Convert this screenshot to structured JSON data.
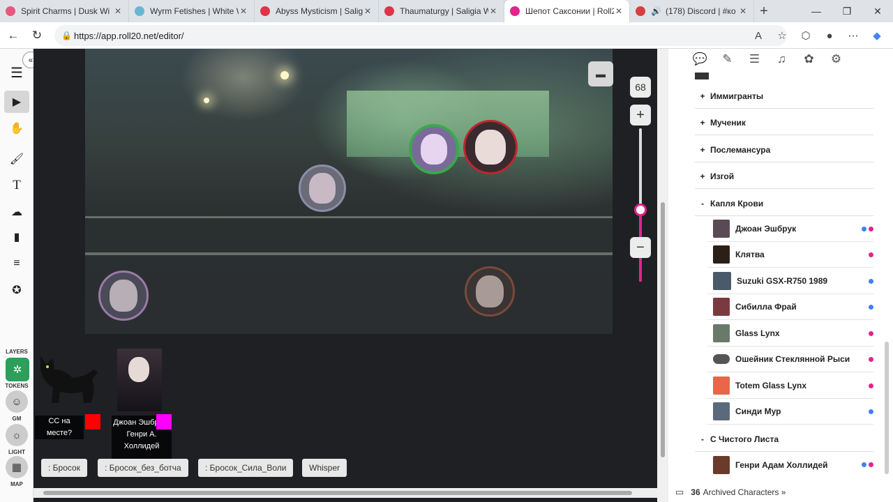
{
  "browser": {
    "tabs": [
      {
        "title": "Spirit Charms | Dusk Wi",
        "color": "#e8577d"
      },
      {
        "title": "Wyrm Fetishes | White W",
        "color": "#67b7d1"
      },
      {
        "title": "Abyss Mysticism | Saligia",
        "color": "#e0334a"
      },
      {
        "title": "Thaumaturgy | Saligia W",
        "color": "#e0334a"
      },
      {
        "title": "Шепот Саксонии | Roll2",
        "color": "#e5238a"
      },
      {
        "title": "(178) Discord | #ко",
        "color": "#d63f3f"
      }
    ],
    "new_tab_icon": "+",
    "url": "https://app.roll20.net/editor/"
  },
  "toolbar": {
    "layers_label": "LAYERS",
    "tokens_label": "TOKENS",
    "gm_label": "GM",
    "light_label": "LIGHT",
    "map_label": "MAP"
  },
  "zoom": {
    "value": "68",
    "plus": "+",
    "minus": "−",
    "level": 0.53
  },
  "macros": [
    ": Бросок",
    ": Бросок_без_ботча",
    ": Бросок_Сила_Воли",
    "Whisper"
  ],
  "tray": {
    "cat_label": "СС на месте?",
    "cat_color": "#ff0000",
    "char_label": "Джоан Эшбрук / Генри А. Холлидей",
    "char_color": "#ff00ff"
  },
  "panel": {
    "folders": [
      {
        "sign": "+",
        "label": "Иммигранты"
      },
      {
        "sign": "+",
        "label": "Мученик"
      },
      {
        "sign": "+",
        "label": "Послемансура"
      },
      {
        "sign": "+",
        "label": "Изгой"
      },
      {
        "sign": "-",
        "label": "Капля Крови"
      }
    ],
    "characters": [
      {
        "name": "Джоан Эшбрук",
        "avatar": "#5a4a55",
        "dots": [
          "#3b82f6",
          "#e5238a"
        ]
      },
      {
        "name": "Клятва",
        "avatar": "#2b2018",
        "dots": [
          "#e5238a"
        ]
      },
      {
        "name": "Suzuki GSX-R750 1989",
        "avatar": "#4a5a6a",
        "dots": [
          "#3b82f6"
        ]
      },
      {
        "name": "Сибилла Фрай",
        "avatar": "#7a3a40",
        "dots": [
          "#3b82f6"
        ]
      },
      {
        "name": "Glass Lynx",
        "avatar": "#6a7a6a",
        "dots": [
          "#e5238a"
        ]
      },
      {
        "name": "Ошейник Стеклянной Рыси",
        "avatar": "#555555",
        "dots": [
          "#e5238a"
        ]
      },
      {
        "name": "Totem Glass Lynx",
        "avatar": "#e8664a",
        "dots": [
          "#e5238a"
        ]
      },
      {
        "name": "Синди Мур",
        "avatar": "#5a6a7a",
        "dots": [
          "#3b82f6"
        ]
      }
    ],
    "folder2": {
      "sign": "-",
      "label": "С Чистого Листа"
    },
    "character2": {
      "name": "Генри Адам Холлидей",
      "avatar": "#6a3a2a",
      "dots": [
        "#3b82f6",
        "#e5238a"
      ]
    },
    "archived_count": "36",
    "archived_label": "Archived Characters »"
  }
}
